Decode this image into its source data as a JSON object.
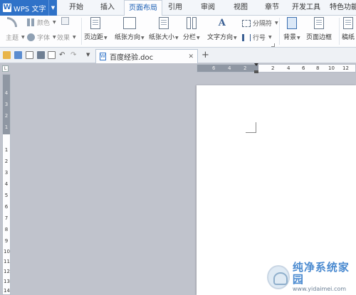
{
  "app": {
    "name": "WPS 文字"
  },
  "tabs": [
    {
      "label": "开始",
      "active": false
    },
    {
      "label": "插入",
      "active": false
    },
    {
      "label": "页面布局",
      "active": true
    },
    {
      "label": "引用",
      "active": false
    },
    {
      "label": "审阅",
      "active": false
    },
    {
      "label": "视图",
      "active": false
    },
    {
      "label": "章节",
      "active": false
    },
    {
      "label": "开发工具",
      "active": false
    },
    {
      "label": "特色功能",
      "active": false
    }
  ],
  "ribbon": {
    "color": "颜色",
    "theme": "主题",
    "font": "字体",
    "effect": "效果",
    "margins": "页边距",
    "orientation": "纸张方向",
    "size": "纸张大小",
    "columns": "分栏",
    "text_direction": "文字方向",
    "breaks": "分隔符",
    "line_numbers": "行号",
    "background": "背景",
    "page_border": "页面边框",
    "manuscript": "稿纸"
  },
  "document": {
    "tab_title": "百度经验.doc"
  },
  "ruler": {
    "horizontal": [
      "6",
      "4",
      "2",
      "2",
      "4",
      "6",
      "8",
      "10",
      "12"
    ],
    "vertical": [
      "4",
      "3",
      "2",
      "1",
      "1",
      "2",
      "3",
      "4",
      "5",
      "6",
      "7",
      "8",
      "9",
      "10",
      "11",
      "12",
      "13",
      "14"
    ]
  },
  "watermark": {
    "title": "纯净系统家园",
    "url": "www.yidaimei.com"
  },
  "colors": {
    "accent": "#2f72c8",
    "active_tab_text": "#1c5fb4"
  }
}
